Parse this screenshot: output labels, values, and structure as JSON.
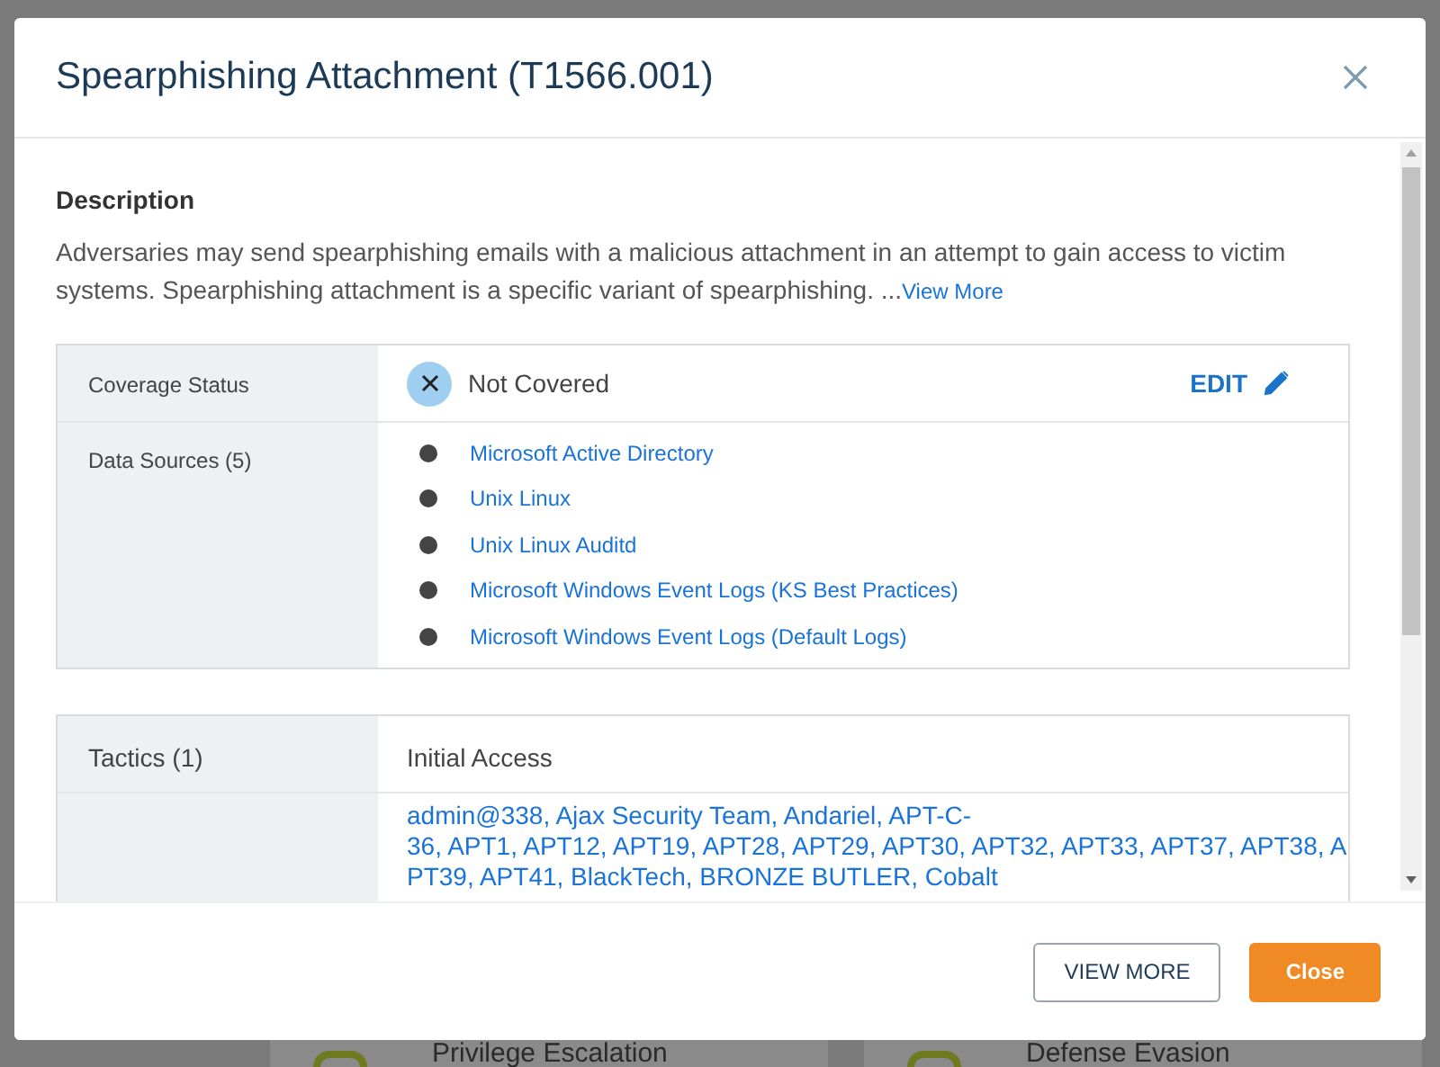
{
  "background": {
    "cards": [
      {
        "title": "Privilege Escalation"
      },
      {
        "title": "Defense Evasion"
      }
    ]
  },
  "modal": {
    "title": "Spearphishing Attachment (T1566.001)",
    "description": {
      "heading": "Description",
      "text": "Adversaries may send spearphishing emails with a malicious attachment in an attempt to gain access to victim systems. Spearphishing attachment is a specific variant of spearphishing. ...",
      "link": "View More"
    },
    "coverage": {
      "label": "Coverage Status",
      "status": "Not Covered",
      "covered": false,
      "edit": "EDIT"
    },
    "data_sources": {
      "label": "Data Sources (5)",
      "items": [
        {
          "name": "Microsoft Active Directory"
        },
        {
          "name": "Unix Linux"
        },
        {
          "name": "Unix Linux Auditd"
        },
        {
          "name": "Microsoft Windows Event Logs (KS Best Practices)"
        },
        {
          "name": "Microsoft Windows Event Logs (Default Logs)"
        }
      ]
    },
    "tactics": {
      "label": "Tactics (1)",
      "value": "Initial Access"
    },
    "groups": {
      "lines": [
        "admin@338, Ajax Security Team, Andariel, APT-C-",
        "36, APT1, APT12, APT19, APT28, APT29, APT30, APT32, APT33, APT37, APT38, A",
        "PT39, APT41, BlackTech, BRONZE BUTLER, Cobalt"
      ]
    },
    "buttons": [
      {
        "label": "VIEW MORE",
        "kind": "secondary"
      },
      {
        "label": "Close",
        "kind": "primary"
      }
    ]
  }
}
